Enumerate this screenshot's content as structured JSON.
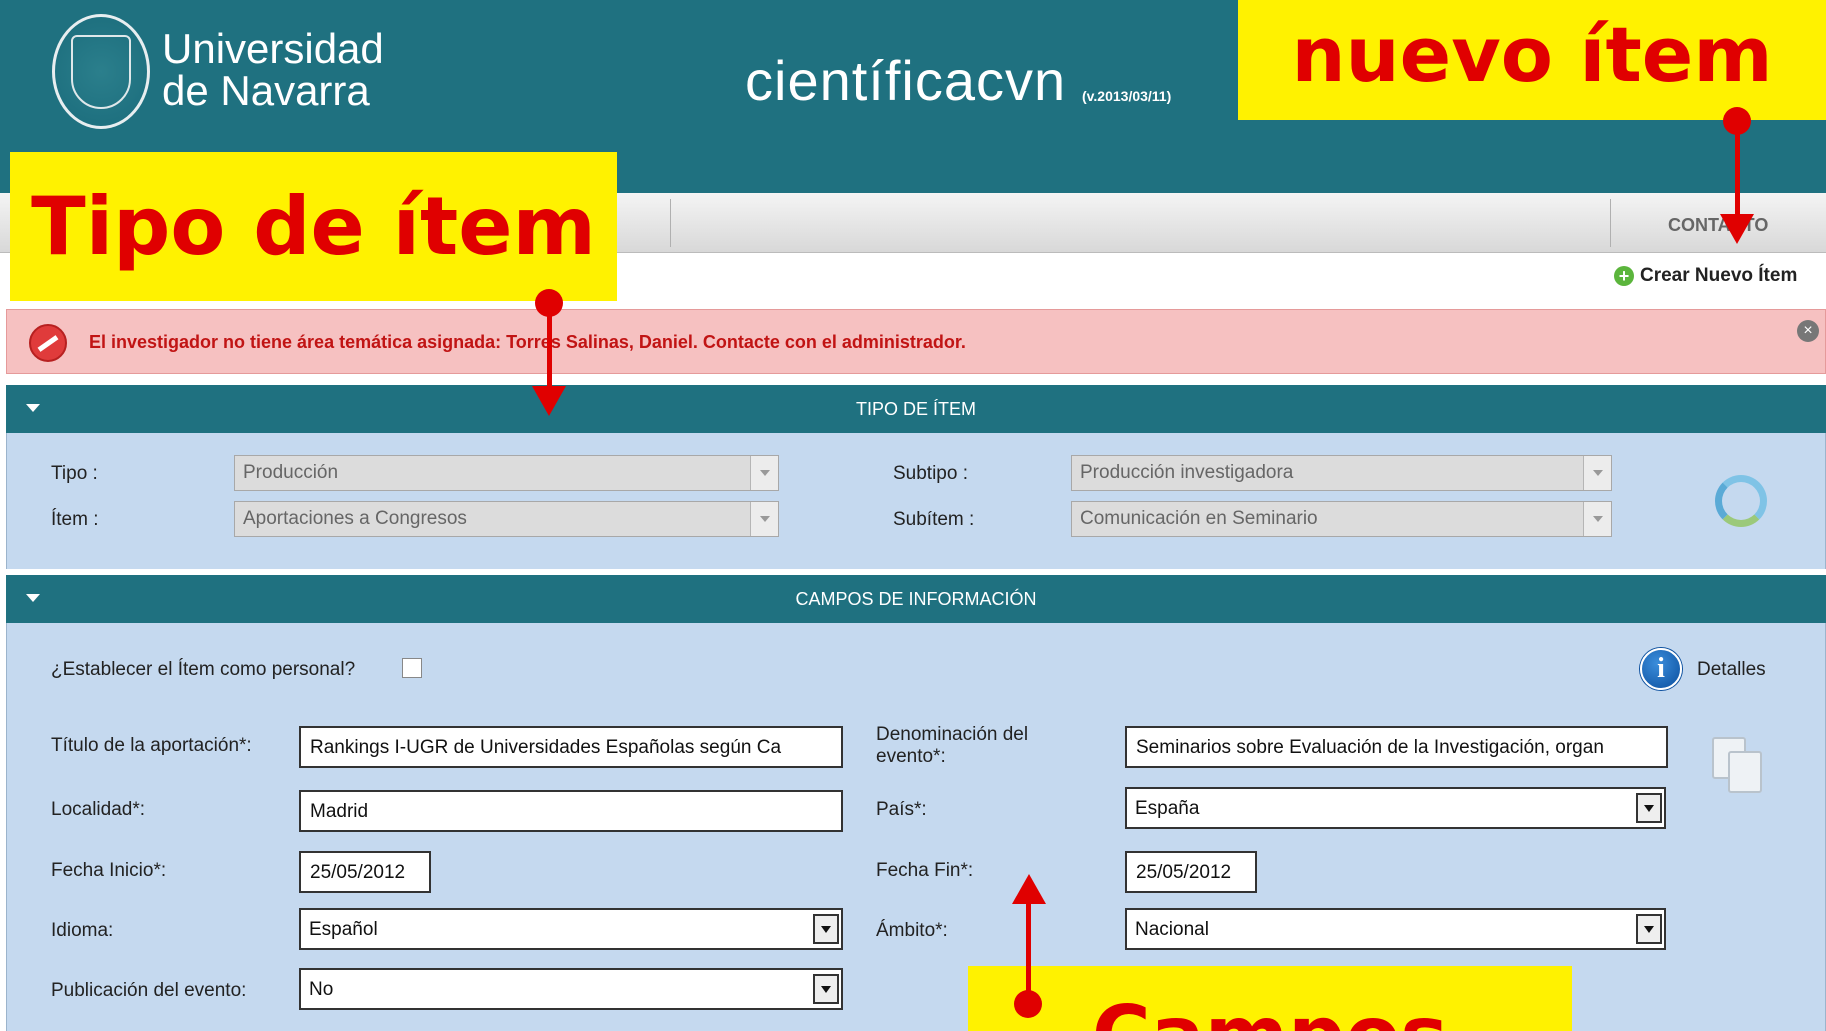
{
  "header": {
    "logo_line1": "Universidad",
    "logo_line2": "de Navarra",
    "app_title": "científicacvn",
    "app_version": "(v.2013/03/11)"
  },
  "nav": {
    "contact_label": "CONTACTO"
  },
  "toolbar": {
    "create_label": "Crear Nuevo Ítem"
  },
  "error": {
    "message": "El investigador no tiene área temática asignada: Torres Salinas, Daniel. Contacte con el administrador."
  },
  "tipo_section": {
    "title": "TIPO DE ÍTEM",
    "tipo_label": "Tipo :",
    "tipo_value": "Producción",
    "subtipo_label": "Subtipo :",
    "subtipo_value": "Producción investigadora",
    "item_label": "Ítem :",
    "item_value": "Aportaciones a Congresos",
    "subitem_label": "Subítem :",
    "subitem_value": "Comunicación en Seminario"
  },
  "campos_section": {
    "title": "CAMPOS DE INFORMACIÓN",
    "personal_label": "¿Establecer el Ítem como personal?",
    "details_label": "Detalles",
    "titulo_label": "Título de la aportación*:",
    "titulo_value": "Rankings I-UGR de Universidades Españolas según Ca",
    "denominacion_label_1": "Denominación del",
    "denominacion_label_2": "evento*:",
    "denominacion_value": "Seminarios sobre Evaluación de la Investigación, organ",
    "localidad_label": "Localidad*:",
    "localidad_value": "Madrid",
    "pais_label": "País*:",
    "pais_value": "España",
    "fecha_inicio_label": "Fecha Inicio*:",
    "fecha_inicio_value": "25/05/2012",
    "fecha_fin_label": "Fecha Fin*:",
    "fecha_fin_value": "25/05/2012",
    "idioma_label": "Idioma:",
    "idioma_value": "Español",
    "ambito_label": "Ámbito*:",
    "ambito_value": "Nacional",
    "publicacion_label": "Publicación del evento:",
    "publicacion_value": "No"
  },
  "annotations": {
    "nuevo_item": "nuevo ítem",
    "tipo_item": "Tipo de ítem",
    "campos": "Campos"
  },
  "colors": {
    "header_teal": "#1f7180",
    "panel_blue": "#c5d9ef",
    "error_bg": "#f6c1c1",
    "annotation_yellow": "#fff200",
    "annotation_red": "#e00000"
  }
}
